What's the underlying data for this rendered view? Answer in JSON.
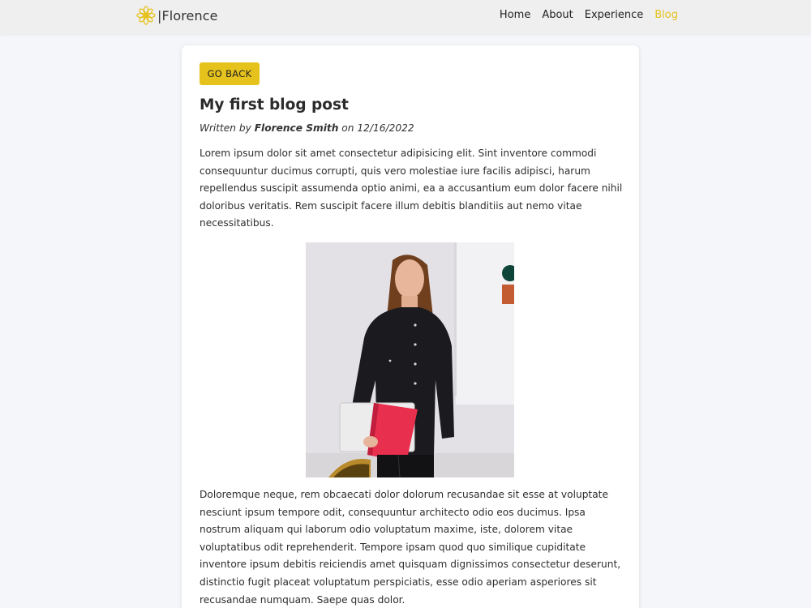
{
  "brand": {
    "name": "|Florence",
    "logo_icon": "sun-flower-icon",
    "accent": "#e6c21c"
  },
  "nav": {
    "items": [
      "Home",
      "About",
      "Experience",
      "Blog"
    ],
    "active": "Blog"
  },
  "post": {
    "back_label": "GO BACK",
    "title": "My first blog post",
    "byline_prefix": "Written by ",
    "author": "Florence Smith",
    "byline_mid": " on ",
    "date": "12/16/2022",
    "para1": "Lorem ipsum dolor sit amet consectetur adipisicing elit. Sint inventore commodi consequuntur ducimus corrupti, quis vero molestiae iure facilis adipisci, harum repellendus suscipit assumenda optio animi, ea a accusantium eum dolor facere nihil doloribus veritatis. Rem suscipit facere illum debitis blanditiis aut nemo vitae necessitatibus.",
    "para2": "Doloremque neque, rem obcaecati dolor dolorum recusandae sit esse at voluptate nesciunt ipsum tempore odit, consequuntur architecto odio eos ducimus. Ipsa nostrum aliquam qui laborum odio voluptatum maxime, iste, dolorem vitae voluptatibus odit reprehenderit. Tempore ipsam quod quo similique cupiditate inventore ipsum debitis reiciendis amet quisquam dignissimos consectetur deserunt, distinctio fugit placeat voluptatum perspiciatis, esse odio aperiam asperiores sit recusandae numquam. Saepe quas dolor."
  }
}
